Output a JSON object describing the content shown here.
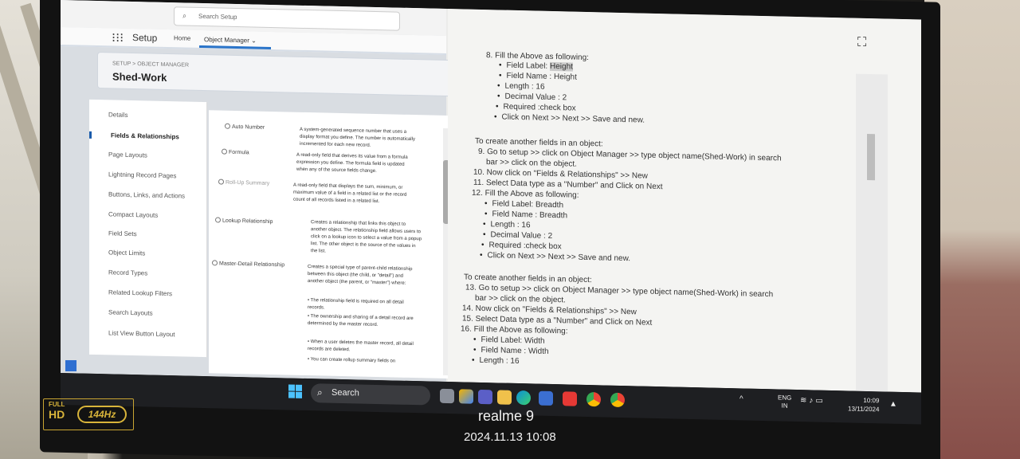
{
  "salesforce": {
    "search_placeholder": "Search Setup",
    "app_name": "Setup",
    "nav": {
      "home": "Home",
      "object_manager": "Object Manager"
    },
    "breadcrumb": "SETUP > OBJECT MANAGER",
    "object_title": "Shed-Work",
    "left_nav": [
      "Details",
      "Fields & Relationships",
      "Page Layouts",
      "Lightning Record Pages",
      "Buttons, Links, and Actions",
      "Compact Layouts",
      "Field Sets",
      "Object Limits",
      "Record Types",
      "Related Lookup Filters",
      "Search Layouts",
      "List View Button Layout"
    ],
    "active_nav_index": 1,
    "field_types": [
      {
        "label": "Auto Number",
        "desc": "A system-generated sequence number that uses a display format you define. The number is automatically incremented for each new record."
      },
      {
        "label": "Formula",
        "desc": "A read-only field that derives its value from a formula expression you define. The formula field is updated when any of the source fields change."
      },
      {
        "label": "Roll-Up Summary",
        "desc": "A read-only field that displays the sum, minimum, or maximum value of a field in a related list or the record count of all records listed in a related list."
      },
      {
        "label": "Lookup Relationship",
        "desc": "Creates a relationship that links this object to another object. The relationship field allows users to click on a lookup icon to select a value from a popup list. The other object is the source of the values in the list."
      },
      {
        "label": "Master-Detail Relationship",
        "desc": "Creates a special type of parent-child relationship between this object (the child, or \"detail\") and another object (the parent, or \"master\") where:"
      }
    ],
    "master_detail_points": [
      "The relationship field is required on all detail records.",
      "The ownership and sharing of a detail record are determined by the master record.",
      "When a user deletes the master record, all detail records are deleted.",
      "You can create rollup summary fields on"
    ]
  },
  "doc": {
    "step8": "8. Fill the Above as following:",
    "block1_bullets": [
      "Field Label: ",
      "Field Name : Height",
      "Length : 16",
      "Decimal Value : 2",
      "Required :check box",
      "Click on Next >> Next >> Save and new."
    ],
    "block1_highlight": "Height",
    "para2_intro": "To create another fields in an object:",
    "step9a": "9. Go to setup >> click on Object Manager >> type object name(Shed-Work) in search",
    "step9b": "bar >> click on the object.",
    "step10": "10. Now click on \"Fields & Relationships\" >> New",
    "step11": "11. Select Data type as a \"Number\" and Click on Next",
    "step12": "12. Fill the Above as following:",
    "block2_bullets": [
      "Field Label: Breadth",
      "Field Name : Breadth",
      "Length : 16",
      "Decimal Value : 2",
      "Required :check box",
      "Click on Next >> Next >> Save and new."
    ],
    "para3_intro": "To create another fields in an object:",
    "step13a": "13. Go to setup >> click on Object Manager >> type object name(Shed-Work) in search",
    "step13b": "bar >> click on the object.",
    "step14": "14. Now click on \"Fields & Relationships\" >> New",
    "step15": "15. Select Data type as a \"Number\" and Click on Next",
    "step16": "16. Fill the Above as following:",
    "block3_bullets": [
      "Field Label: Width",
      "Field Name : Width",
      "Length : 16"
    ]
  },
  "taskbar": {
    "search_label": "Search",
    "lang_top": "ENG",
    "lang_bottom": "IN",
    "time": "10:09",
    "date": "13/11/2024"
  },
  "badge": {
    "full": "FULL",
    "hd": "HD",
    "hz": "144Hz"
  },
  "watermark": {
    "brand": "realme 9",
    "datetime": "2024.11.13 10:08"
  }
}
